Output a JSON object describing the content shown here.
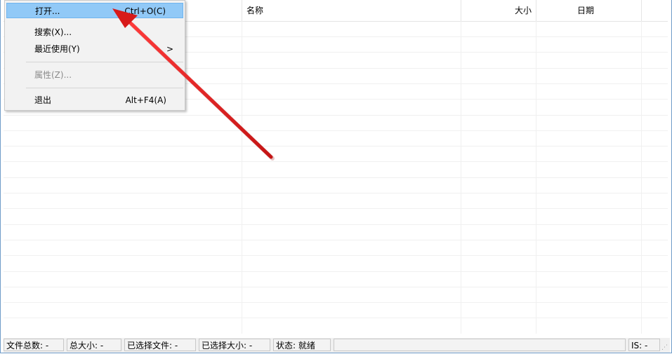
{
  "columns": {
    "name": "名称",
    "size": "大小",
    "date": "日期"
  },
  "menu": {
    "items": [
      {
        "label": "打开...",
        "shortcut": "Ctrl+O(C)"
      },
      {
        "label": "搜索(X)...",
        "shortcut": ""
      },
      {
        "label": "最近使用(Y)",
        "shortcut": "",
        "submenu_arrow": ">"
      },
      {
        "label": "属性(Z)...",
        "shortcut": ""
      },
      {
        "label": "退出",
        "shortcut": "Alt+F4(A)"
      }
    ]
  },
  "statusbar": {
    "total_files": "文件总数: -",
    "total_size": "总大小: -",
    "selected_files": "已选择文件: -",
    "selected_size": "已选择大小: -",
    "status": "状态: 就绪",
    "is": "IS: -"
  },
  "colors": {
    "highlight": "#91c9f7",
    "arrow": "#e02020"
  }
}
